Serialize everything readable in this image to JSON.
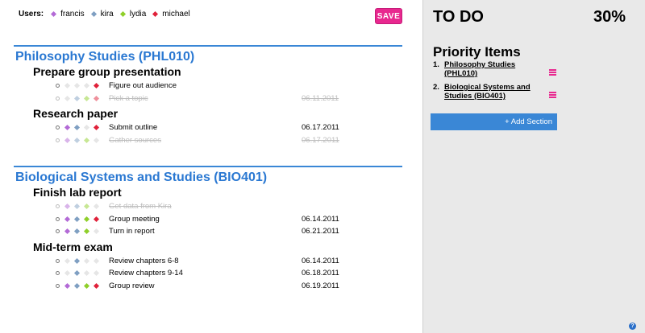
{
  "users": {
    "label": "Users:",
    "list": [
      {
        "name": "francis",
        "color": "#b36ad6"
      },
      {
        "name": "kira",
        "color": "#7f9fc2"
      },
      {
        "name": "lydia",
        "color": "#8fcf2a"
      },
      {
        "name": "michael",
        "color": "#e0213a"
      }
    ]
  },
  "save_label": "SAVE",
  "colors": {
    "accent_blue": "#3a87d6",
    "accent_pink": "#e8288f",
    "francis": "#b36ad6",
    "kira": "#7f9fc2",
    "lydia": "#8fcf2a",
    "michael": "#e0213a"
  },
  "sections": [
    {
      "title": "Philosophy Studies (PHL010)",
      "tasks": [
        {
          "title": "Prepare group presentation",
          "items": [
            {
              "text": "Figure out audience",
              "date": "",
              "done": false,
              "assignees": [
                "michael"
              ]
            },
            {
              "text": "Pick a topic",
              "date": "06.11.2011",
              "done": true,
              "assignees": [
                "kira",
                "lydia",
                "michael"
              ]
            }
          ]
        },
        {
          "title": "Research paper",
          "items": [
            {
              "text": "Submit outline",
              "date": "06.17.2011",
              "done": false,
              "assignees": [
                "francis",
                "kira",
                "michael"
              ]
            },
            {
              "text": "Gather sources",
              "date": "06.17.2011",
              "done": true,
              "assignees": [
                "francis",
                "kira",
                "lydia"
              ]
            }
          ]
        }
      ]
    },
    {
      "title": "Biological Systems and Studies (BIO401)",
      "tasks": [
        {
          "title": "Finish lab report",
          "items": [
            {
              "text": "Get data from Kira",
              "date": "",
              "done": true,
              "assignees": [
                "francis",
                "kira",
                "lydia"
              ]
            },
            {
              "text": "Group meeting",
              "date": "06.14.2011",
              "done": false,
              "assignees": [
                "francis",
                "kira",
                "lydia",
                "michael"
              ]
            },
            {
              "text": "Turn in report",
              "date": "06.21.2011",
              "done": false,
              "assignees": [
                "francis",
                "kira",
                "lydia"
              ]
            }
          ]
        },
        {
          "title": "Mid-term exam",
          "items": [
            {
              "text": "Review chapters 6-8",
              "date": "06.14.2011",
              "done": false,
              "assignees": [
                "kira"
              ]
            },
            {
              "text": "Review chapters 9-14",
              "date": "06.18.2011",
              "done": false,
              "assignees": [
                "kira"
              ]
            },
            {
              "text": "Group review",
              "date": "06.19.2011",
              "done": false,
              "assignees": [
                "francis",
                "kira",
                "lydia",
                "michael"
              ]
            }
          ]
        }
      ]
    }
  ],
  "sidebar": {
    "title": "TO DO",
    "percent": "30%",
    "priority_title": "Priority Items",
    "priority_items": [
      {
        "num": "1.",
        "label": "Philosophy Studies (PHL010)"
      },
      {
        "num": "2.",
        "label": "Biological Systems and Studies (BIO401)"
      }
    ],
    "add_section_label": "+ Add Section",
    "help_glyph": "?"
  }
}
